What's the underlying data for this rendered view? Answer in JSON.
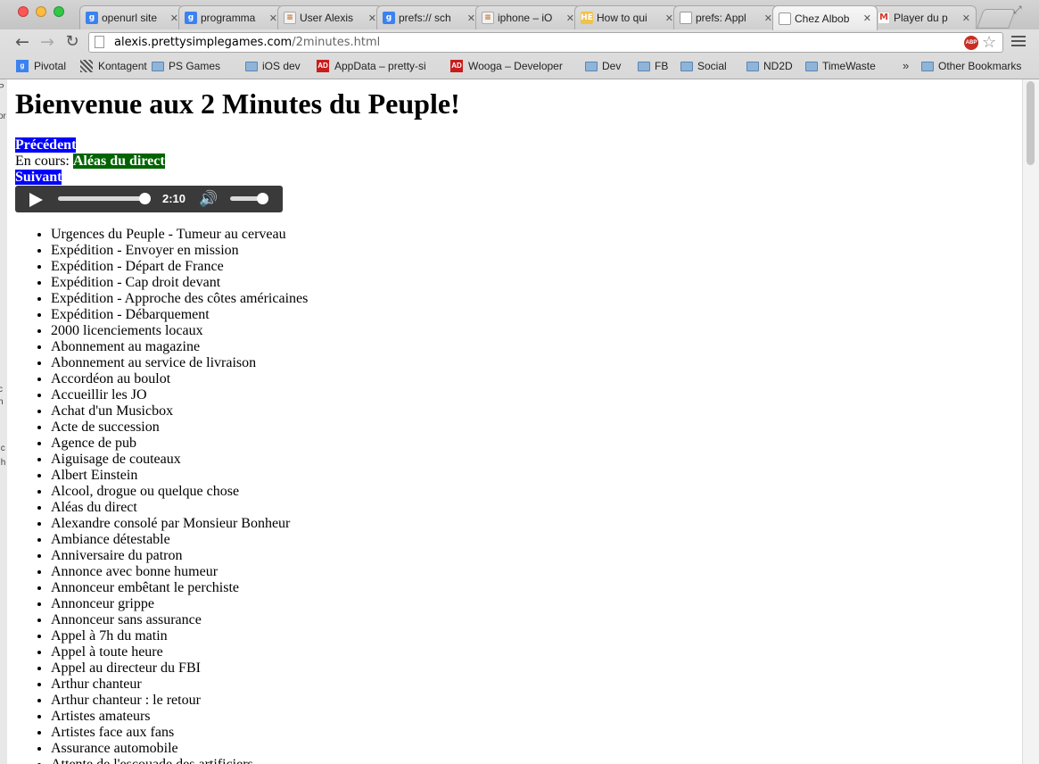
{
  "browser": {
    "tabs": [
      {
        "title": "openurl site",
        "icon": "google-icon"
      },
      {
        "title": "programma",
        "icon": "google-icon"
      },
      {
        "title": "User Alexis",
        "icon": "stackoverflow-icon"
      },
      {
        "title": "prefs:// sch",
        "icon": "google-icon"
      },
      {
        "title": "iphone – iO",
        "icon": "stackoverflow-icon"
      },
      {
        "title": "How to qui",
        "icon": "he-icon"
      },
      {
        "title": "prefs: Appl",
        "icon": "page-icon"
      },
      {
        "title": "Chez Albob",
        "icon": "page-icon"
      },
      {
        "title": "Player du p",
        "icon": "gmail-icon"
      }
    ],
    "active_tab": 7,
    "url_domain": "alexis.prettysimplegames.com",
    "url_path": "/2minutes.html",
    "abp_label": "ABP",
    "bookmarks": [
      {
        "label": "Pivotal",
        "icon": "google-icon"
      },
      {
        "label": "Kontagent",
        "icon": "kontagent-icon"
      },
      {
        "label": "PS Games",
        "icon": "folder-icon"
      },
      {
        "label": "iOS dev",
        "icon": "folder-icon"
      },
      {
        "label": "AppData – pretty-si",
        "icon": "appdata-icon"
      },
      {
        "label": "Wooga – Developer",
        "icon": "appdata-icon"
      },
      {
        "label": "Dev",
        "icon": "folder-icon"
      },
      {
        "label": "FB",
        "icon": "folder-icon"
      },
      {
        "label": "Social",
        "icon": "folder-icon"
      },
      {
        "label": "ND2D",
        "icon": "folder-icon"
      },
      {
        "label": "TimeWaste",
        "icon": "folder-icon"
      }
    ],
    "more_bookmarks": "»",
    "other_bookmarks": "Other Bookmarks"
  },
  "page": {
    "title": "Bienvenue aux 2 Minutes du Peuple!",
    "previous_label": "Précédent",
    "current_prefix": "En cours: ",
    "current_track": "Aléas du direct",
    "next_label": "Suivant",
    "player": {
      "time": "2:10",
      "progress": 1.0,
      "volume": 1.0
    },
    "tracks": [
      "Urgences du Peuple - Tumeur au cerveau",
      "Expédition - Envoyer en mission",
      "Expédition - Départ de France",
      "Expédition - Cap droit devant",
      "Expédition - Approche des côtes américaines",
      "Expédition - Débarquement",
      "2000 licenciements locaux",
      "Abonnement au magazine",
      "Abonnement au service de livraison",
      "Accordéon au boulot",
      "Accueillir les JO",
      "Achat d'un Musicbox",
      "Acte de succession",
      "Agence de pub",
      "Aiguisage de couteaux",
      "Albert Einstein",
      "Alcool, drogue ou quelque chose",
      "Aléas du direct",
      "Alexandre consolé par Monsieur Bonheur",
      "Ambiance détestable",
      "Anniversaire du patron",
      "Annonce avec bonne humeur",
      "Annonceur embêtant le perchiste",
      "Annonceur grippe",
      "Annonceur sans assurance",
      "Appel à 7h du matin",
      "Appel à toute heure",
      "Appel au directeur du FBI",
      "Arthur chanteur",
      "Arthur chanteur : le retour",
      "Artistes amateurs",
      "Artistes face aux fans",
      "Assurance automobile",
      "Attente de l'escouade des artificiers"
    ]
  }
}
